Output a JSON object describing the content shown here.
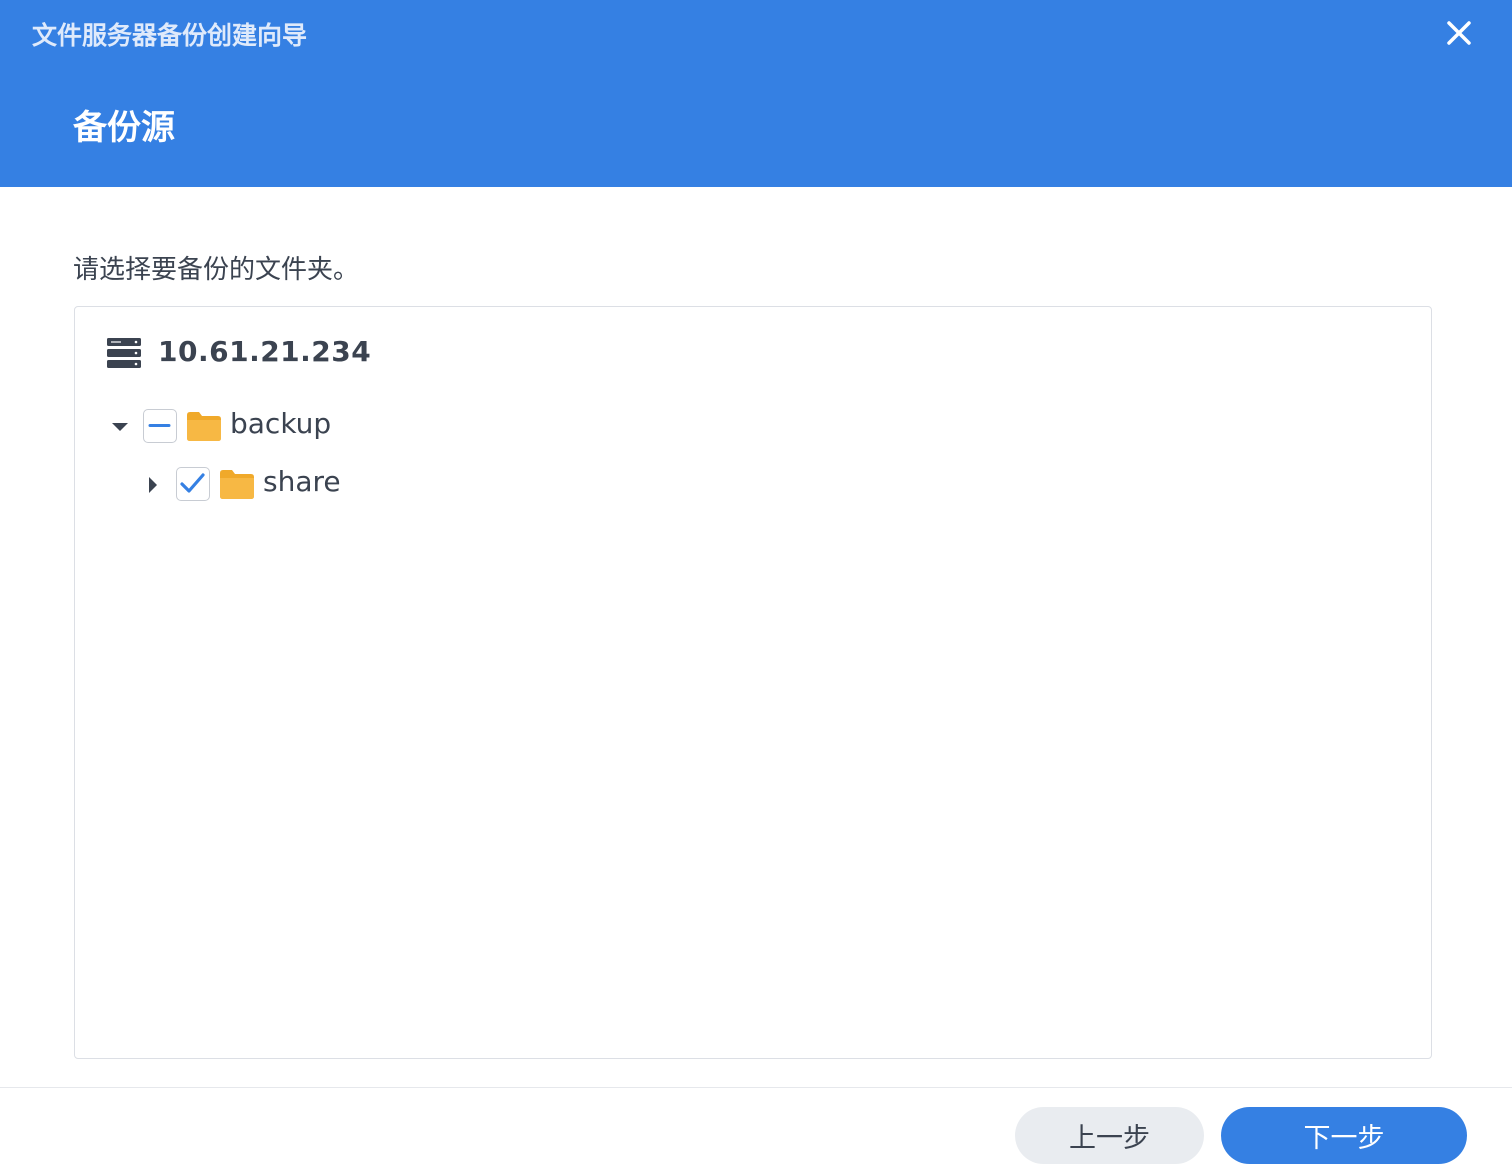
{
  "window": {
    "title": "文件服务器备份创建向导",
    "close_icon": "close-icon"
  },
  "step": {
    "title": "备份源",
    "instruction": "请选择要备份的文件夹。"
  },
  "tree": {
    "server": {
      "icon": "server-icon",
      "label": "10.61.21.234"
    },
    "nodes": [
      {
        "label": "backup",
        "expanded": true,
        "check_state": "indeterminate",
        "icon": "folder-icon",
        "depth": 0
      },
      {
        "label": "share",
        "expanded": false,
        "check_state": "checked",
        "icon": "folder-icon",
        "depth": 1
      }
    ]
  },
  "footer": {
    "prev_label": "上一步",
    "next_label": "下一步"
  },
  "colors": {
    "accent": "#3580e3",
    "folder": "#f5b335",
    "text": "#3b4350",
    "secondary_button": "#e9ecf0"
  }
}
